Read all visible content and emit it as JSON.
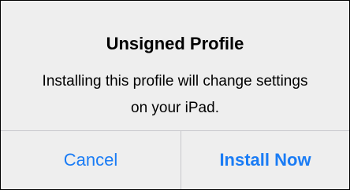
{
  "dialog": {
    "title": "Unsigned Profile",
    "message": "Installing this profile will change settings on your iPad.",
    "buttons": {
      "cancel": "Cancel",
      "install": "Install Now"
    }
  },
  "colors": {
    "background": "#eeeeee",
    "button_text": "#1a7cf5",
    "divider": "#c8c8cc"
  }
}
